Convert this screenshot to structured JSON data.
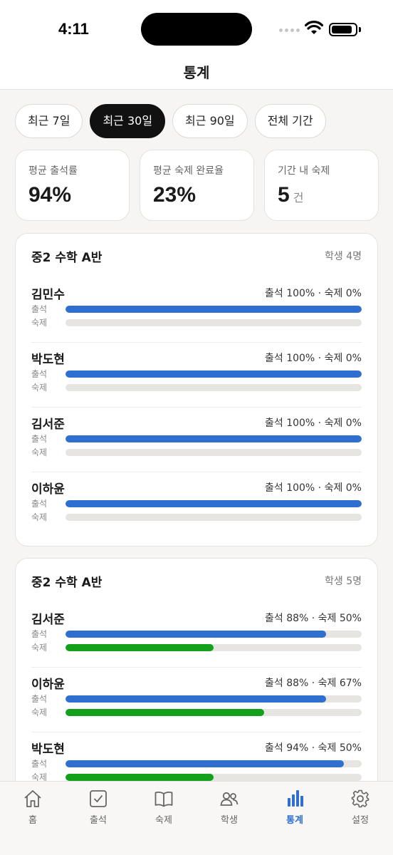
{
  "status": {
    "time": "4:11"
  },
  "header": {
    "title": "통계"
  },
  "tabs": [
    {
      "label": "최근 7일",
      "active": false
    },
    {
      "label": "최근 30일",
      "active": true
    },
    {
      "label": "최근 90일",
      "active": false
    },
    {
      "label": "전체 기간",
      "active": false
    }
  ],
  "summary": {
    "attendance": {
      "label": "평균 출석률",
      "value": "94%"
    },
    "homework": {
      "label": "평균 숙제 완료율",
      "value": "23%"
    },
    "count": {
      "label": "기간 내 숙제",
      "value": "5",
      "unit": "건"
    }
  },
  "bar_labels": {
    "attendance": "출석",
    "homework": "숙제"
  },
  "classes": [
    {
      "name": "중2 수학 A반",
      "count": "학생 4명",
      "students": [
        {
          "name": "김민수",
          "stats": "출석 100% · 숙제 0%",
          "attendance": 100,
          "homework": 0
        },
        {
          "name": "박도현",
          "stats": "출석 100% · 숙제 0%",
          "attendance": 100,
          "homework": 0
        },
        {
          "name": "김서준",
          "stats": "출석 100% · 숙제 0%",
          "attendance": 100,
          "homework": 0
        },
        {
          "name": "이하윤",
          "stats": "출석 100% · 숙제 0%",
          "attendance": 100,
          "homework": 0
        }
      ]
    },
    {
      "name": "중2 수학 A반",
      "count": "학생 5명",
      "students": [
        {
          "name": "김서준",
          "stats": "출석 88% · 숙제 50%",
          "attendance": 88,
          "homework": 50
        },
        {
          "name": "이하윤",
          "stats": "출석 88% · 숙제 67%",
          "attendance": 88,
          "homework": 67
        },
        {
          "name": "박도현",
          "stats": "출석 94% · 숙제 50%",
          "attendance": 94,
          "homework": 50
        }
      ]
    }
  ],
  "nav": [
    {
      "label": "홈",
      "icon": "home-icon",
      "active": false
    },
    {
      "label": "출석",
      "icon": "checkbox-icon",
      "active": false
    },
    {
      "label": "숙제",
      "icon": "book-icon",
      "active": false
    },
    {
      "label": "학생",
      "icon": "people-icon",
      "active": false
    },
    {
      "label": "통계",
      "icon": "bar-chart-icon",
      "active": true
    },
    {
      "label": "설정",
      "icon": "gear-icon",
      "active": false
    }
  ],
  "colors": {
    "attendance_bar": "#2f6fd0",
    "homework_bar": "#13a11c",
    "active_nav": "#2f6fd0"
  }
}
